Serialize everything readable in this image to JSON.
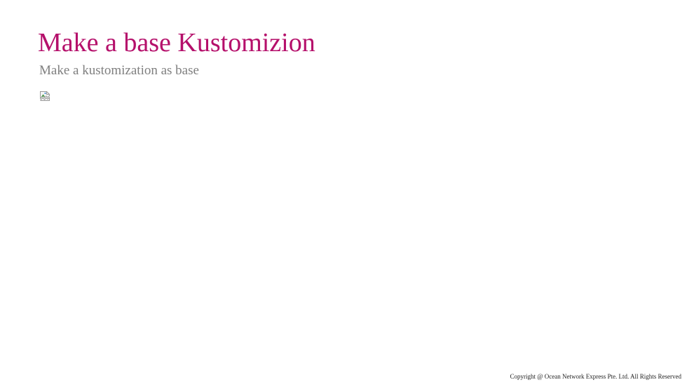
{
  "slide": {
    "title": "Make a base Kustomizion",
    "subtitle": "Make a kustomization as base"
  },
  "image": {
    "icon": "broken-image-icon"
  },
  "footer": {
    "copyright": "Copyright @ Ocean Network Express Pte. Ltd. All Rights Reserved"
  },
  "colors": {
    "title": "#b5106b",
    "subtitle": "#7f7f7f",
    "footer": "#222222",
    "background": "#ffffff"
  }
}
